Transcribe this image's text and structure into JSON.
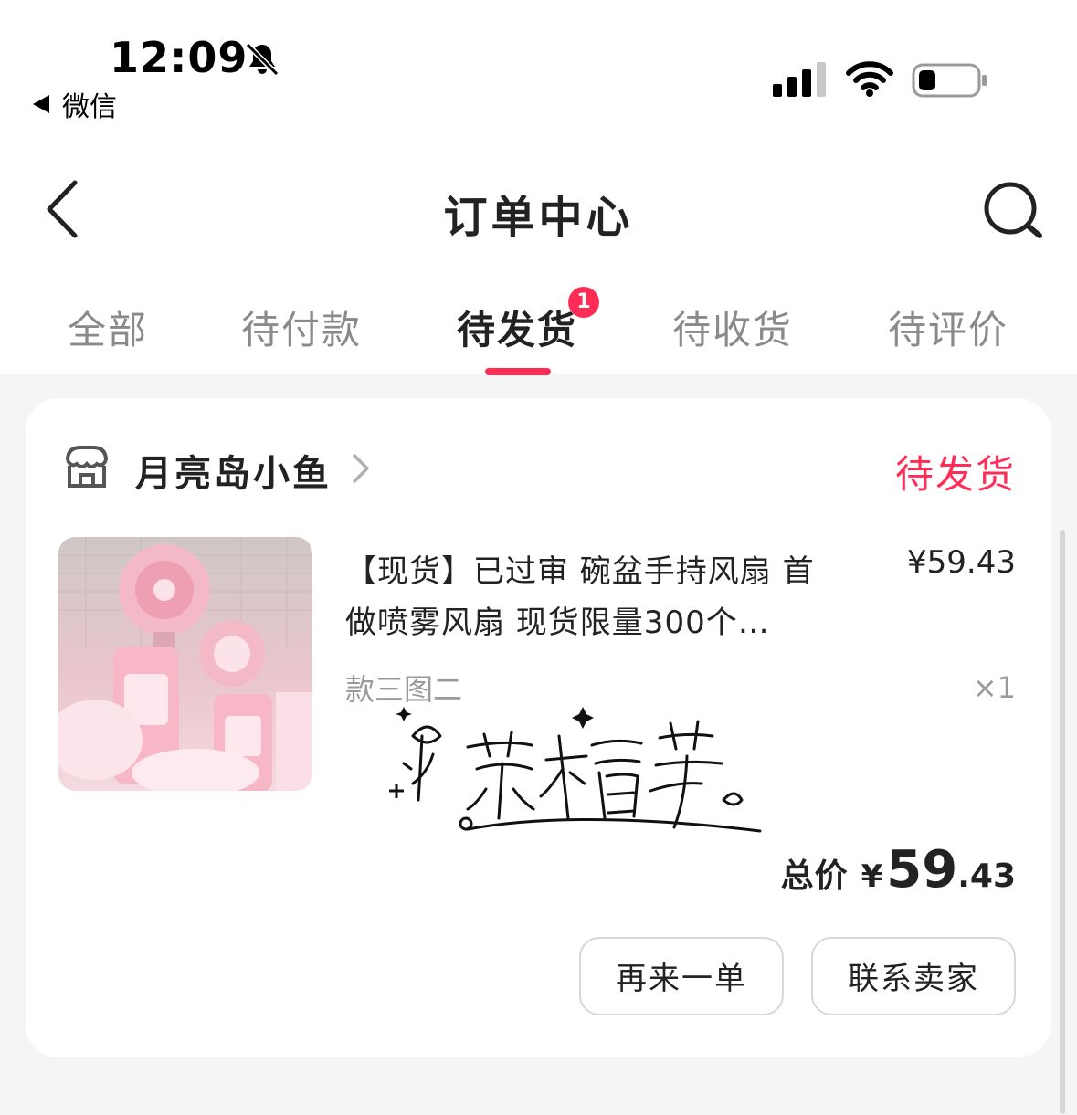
{
  "status_bar": {
    "time": "12:09",
    "back_app_label": "微信"
  },
  "nav": {
    "title": "订单中心"
  },
  "tabs": [
    {
      "label": "全部"
    },
    {
      "label": "待付款"
    },
    {
      "label": "待发货",
      "active": true,
      "badge": "1"
    },
    {
      "label": "待收货"
    },
    {
      "label": "待评价"
    }
  ],
  "order": {
    "shop_name": "月亮岛小鱼",
    "status": "待发货",
    "product": {
      "title": "【现货】已过审 碗盆手持风扇 首做喷雾风扇 现货限量300个…",
      "price": "¥59.43",
      "variant": "款三图二",
      "quantity": "×1",
      "signature_text": "小茶椿芽"
    },
    "total": {
      "label": "总价",
      "currency": "¥",
      "integer": "59",
      "decimal": ".43"
    },
    "buttons": {
      "reorder": "再来一单",
      "contact": "联系卖家"
    }
  },
  "colors": {
    "accent": "#ff2d55",
    "background": "#f5f5f5",
    "card": "#ffffff"
  },
  "icons": [
    "bell-muted-icon",
    "cellular-signal-icon",
    "wifi-icon",
    "battery-icon",
    "back-chevron-icon",
    "search-icon",
    "shop-icon",
    "chevron-right-icon"
  ]
}
